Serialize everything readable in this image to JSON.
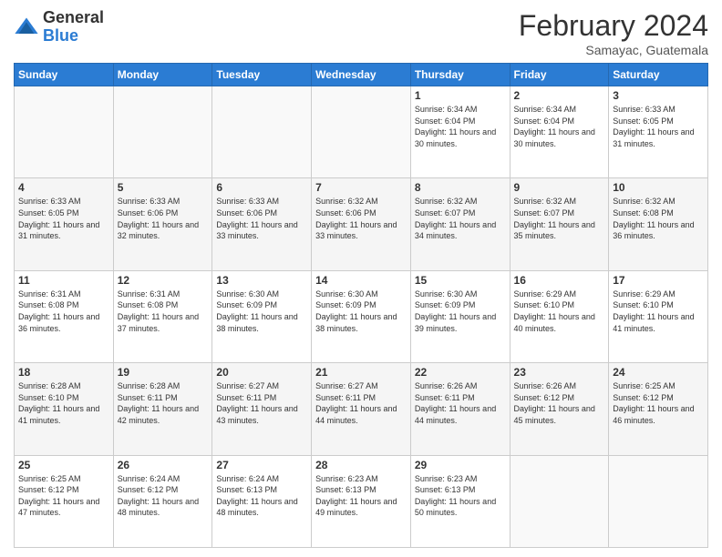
{
  "logo": {
    "general": "General",
    "blue": "Blue"
  },
  "header": {
    "month": "February 2024",
    "location": "Samayac, Guatemala"
  },
  "weekdays": [
    "Sunday",
    "Monday",
    "Tuesday",
    "Wednesday",
    "Thursday",
    "Friday",
    "Saturday"
  ],
  "weeks": [
    [
      {
        "day": "",
        "info": ""
      },
      {
        "day": "",
        "info": ""
      },
      {
        "day": "",
        "info": ""
      },
      {
        "day": "",
        "info": ""
      },
      {
        "day": "1",
        "info": "Sunrise: 6:34 AM\nSunset: 6:04 PM\nDaylight: 11 hours and 30 minutes."
      },
      {
        "day": "2",
        "info": "Sunrise: 6:34 AM\nSunset: 6:04 PM\nDaylight: 11 hours and 30 minutes."
      },
      {
        "day": "3",
        "info": "Sunrise: 6:33 AM\nSunset: 6:05 PM\nDaylight: 11 hours and 31 minutes."
      }
    ],
    [
      {
        "day": "4",
        "info": "Sunrise: 6:33 AM\nSunset: 6:05 PM\nDaylight: 11 hours and 31 minutes."
      },
      {
        "day": "5",
        "info": "Sunrise: 6:33 AM\nSunset: 6:06 PM\nDaylight: 11 hours and 32 minutes."
      },
      {
        "day": "6",
        "info": "Sunrise: 6:33 AM\nSunset: 6:06 PM\nDaylight: 11 hours and 33 minutes."
      },
      {
        "day": "7",
        "info": "Sunrise: 6:32 AM\nSunset: 6:06 PM\nDaylight: 11 hours and 33 minutes."
      },
      {
        "day": "8",
        "info": "Sunrise: 6:32 AM\nSunset: 6:07 PM\nDaylight: 11 hours and 34 minutes."
      },
      {
        "day": "9",
        "info": "Sunrise: 6:32 AM\nSunset: 6:07 PM\nDaylight: 11 hours and 35 minutes."
      },
      {
        "day": "10",
        "info": "Sunrise: 6:32 AM\nSunset: 6:08 PM\nDaylight: 11 hours and 36 minutes."
      }
    ],
    [
      {
        "day": "11",
        "info": "Sunrise: 6:31 AM\nSunset: 6:08 PM\nDaylight: 11 hours and 36 minutes."
      },
      {
        "day": "12",
        "info": "Sunrise: 6:31 AM\nSunset: 6:08 PM\nDaylight: 11 hours and 37 minutes."
      },
      {
        "day": "13",
        "info": "Sunrise: 6:30 AM\nSunset: 6:09 PM\nDaylight: 11 hours and 38 minutes."
      },
      {
        "day": "14",
        "info": "Sunrise: 6:30 AM\nSunset: 6:09 PM\nDaylight: 11 hours and 38 minutes."
      },
      {
        "day": "15",
        "info": "Sunrise: 6:30 AM\nSunset: 6:09 PM\nDaylight: 11 hours and 39 minutes."
      },
      {
        "day": "16",
        "info": "Sunrise: 6:29 AM\nSunset: 6:10 PM\nDaylight: 11 hours and 40 minutes."
      },
      {
        "day": "17",
        "info": "Sunrise: 6:29 AM\nSunset: 6:10 PM\nDaylight: 11 hours and 41 minutes."
      }
    ],
    [
      {
        "day": "18",
        "info": "Sunrise: 6:28 AM\nSunset: 6:10 PM\nDaylight: 11 hours and 41 minutes."
      },
      {
        "day": "19",
        "info": "Sunrise: 6:28 AM\nSunset: 6:11 PM\nDaylight: 11 hours and 42 minutes."
      },
      {
        "day": "20",
        "info": "Sunrise: 6:27 AM\nSunset: 6:11 PM\nDaylight: 11 hours and 43 minutes."
      },
      {
        "day": "21",
        "info": "Sunrise: 6:27 AM\nSunset: 6:11 PM\nDaylight: 11 hours and 44 minutes."
      },
      {
        "day": "22",
        "info": "Sunrise: 6:26 AM\nSunset: 6:11 PM\nDaylight: 11 hours and 44 minutes."
      },
      {
        "day": "23",
        "info": "Sunrise: 6:26 AM\nSunset: 6:12 PM\nDaylight: 11 hours and 45 minutes."
      },
      {
        "day": "24",
        "info": "Sunrise: 6:25 AM\nSunset: 6:12 PM\nDaylight: 11 hours and 46 minutes."
      }
    ],
    [
      {
        "day": "25",
        "info": "Sunrise: 6:25 AM\nSunset: 6:12 PM\nDaylight: 11 hours and 47 minutes."
      },
      {
        "day": "26",
        "info": "Sunrise: 6:24 AM\nSunset: 6:12 PM\nDaylight: 11 hours and 48 minutes."
      },
      {
        "day": "27",
        "info": "Sunrise: 6:24 AM\nSunset: 6:13 PM\nDaylight: 11 hours and 48 minutes."
      },
      {
        "day": "28",
        "info": "Sunrise: 6:23 AM\nSunset: 6:13 PM\nDaylight: 11 hours and 49 minutes."
      },
      {
        "day": "29",
        "info": "Sunrise: 6:23 AM\nSunset: 6:13 PM\nDaylight: 11 hours and 50 minutes."
      },
      {
        "day": "",
        "info": ""
      },
      {
        "day": "",
        "info": ""
      }
    ]
  ]
}
